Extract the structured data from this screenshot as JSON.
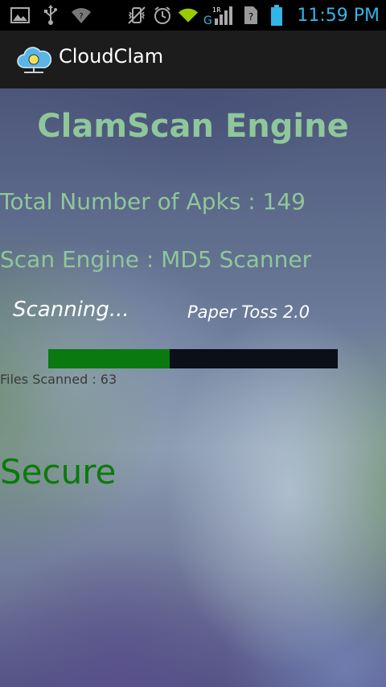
{
  "status_bar": {
    "time": "11:59 PM",
    "network_label": "G",
    "roaming_label": "1R",
    "icons": [
      "image-icon",
      "usb-icon",
      "wifi-question-icon",
      "vibrate-icon",
      "alarm-icon",
      "wifi-icon",
      "signal-icon",
      "no-sim-icon",
      "battery-icon"
    ]
  },
  "action_bar": {
    "title": "CloudClam",
    "icon": "cloud-clam-icon"
  },
  "main": {
    "engine_title": "ClamScan Engine",
    "total_apks": "Total Number of Apks : 149",
    "scan_engine": "Scan Engine : MD5 Scanner",
    "scanning_label": "Scanning...",
    "current_app": "Paper Toss 2.0",
    "progress_fraction": 0.42,
    "files_scanned": "Files Scanned : 63",
    "status": "Secure"
  },
  "colors": {
    "accent_text": "#8fc79a",
    "secure": "#0b7a0b",
    "progress": "#0a7a10",
    "time": "#33b5e5"
  }
}
